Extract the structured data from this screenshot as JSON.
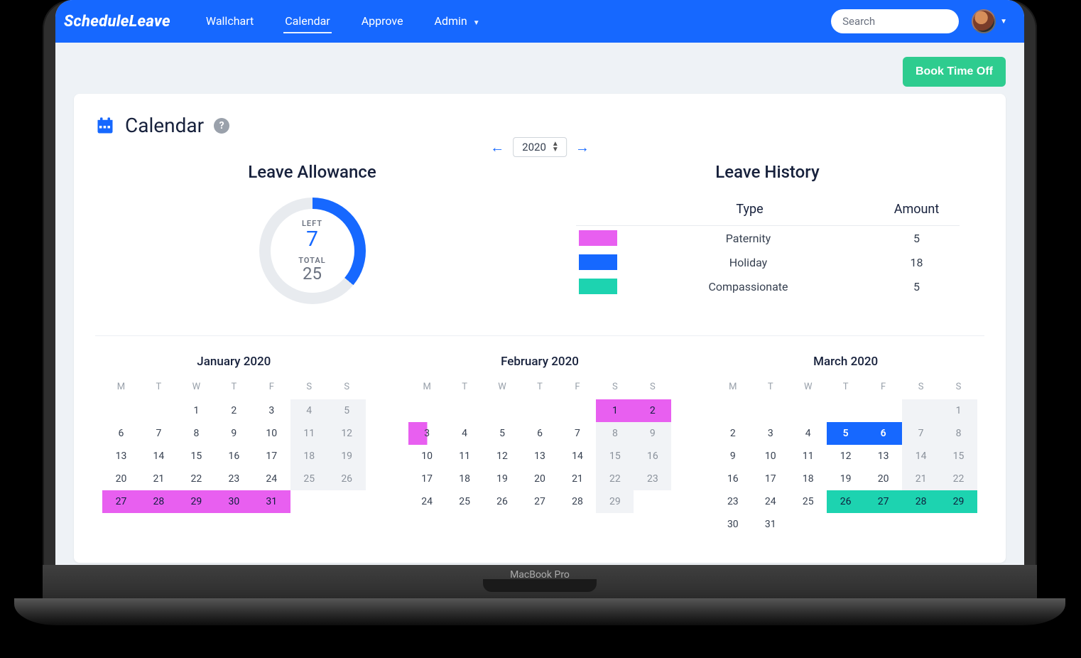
{
  "brand": "ScheduleLeave",
  "nav": {
    "items": [
      "Wallchart",
      "Calendar",
      "Approve",
      "Admin"
    ],
    "active_index": 1
  },
  "search": {
    "placeholder": "Search"
  },
  "header": {
    "book_btn": "Book Time Off"
  },
  "page": {
    "title": "Calendar",
    "year": "2020"
  },
  "allowance": {
    "heading": "Leave Allowance",
    "left_label": "LEFT",
    "left_value": "7",
    "total_label": "TOTAL",
    "total_value": "25",
    "used_fraction": 0.36
  },
  "history": {
    "heading": "Leave History",
    "cols": {
      "type": "Type",
      "amount": "Amount"
    },
    "rows": [
      {
        "color": "magenta",
        "type": "Paternity",
        "amount": "5"
      },
      {
        "color": "blue",
        "type": "Holiday",
        "amount": "18"
      },
      {
        "color": "teal",
        "type": "Compassionate",
        "amount": "5"
      }
    ]
  },
  "dow": [
    "M",
    "T",
    "W",
    "T",
    "F",
    "S",
    "S"
  ],
  "months": [
    {
      "title": "January 2020",
      "lead_blanks": 2,
      "days": 31,
      "weekend_cols": [
        5,
        6
      ],
      "highlights": {
        "27": "mag",
        "28": "mag",
        "29": "mag",
        "30": "mag",
        "31": "mag"
      }
    },
    {
      "title": "February 2020",
      "lead_blanks": 5,
      "days": 29,
      "weekend_cols": [
        5,
        6
      ],
      "highlights": {
        "1": "mag",
        "2": "mag",
        "3": "mag-half-l"
      }
    },
    {
      "title": "March 2020",
      "lead_blanks": 6,
      "days": 31,
      "weekend_cols": [
        5,
        6
      ],
      "highlights": {
        "5": "blue",
        "6": "blue",
        "26": "teal",
        "27": "teal",
        "28": "teal",
        "29": "teal"
      }
    }
  ],
  "laptop_label": "MacBook Pro"
}
